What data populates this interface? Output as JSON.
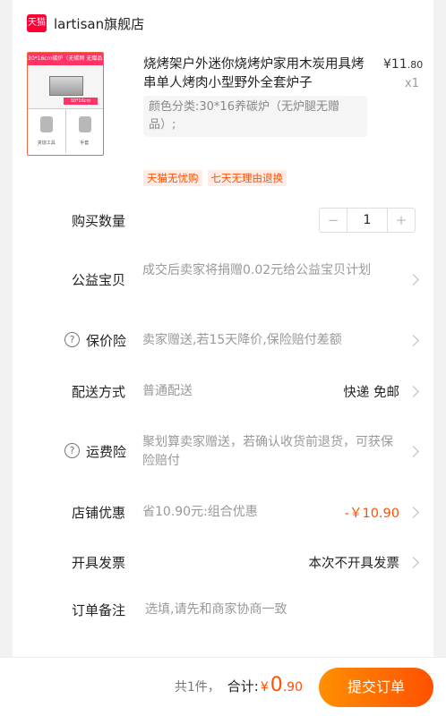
{
  "store": {
    "logo_text": "天猫",
    "name": "lartisan旗舰店"
  },
  "product": {
    "thumb_banner": "30*16cm碳炉（无碳网 无赠品）",
    "thumb_dim": "30*16cm",
    "thumb_captions": [
      "夹烧工具",
      "手套"
    ],
    "title": "烧烤架户外迷你烧烤炉家用木炭用具烤串单人烤肉小型野外全套炉子",
    "price_symbol": "¥",
    "price_int": "11",
    "price_dec": ".80",
    "quantity_text": "x1",
    "spec": "颜色分类:30*16养碳炉（无炉腿无赠品）;",
    "tags": [
      "天猫无忧购",
      "七天无理由退换"
    ]
  },
  "purchase_qty": {
    "label": "购买数量",
    "minus": "−",
    "value": "1",
    "plus": "+"
  },
  "charity": {
    "label": "公益宝贝",
    "desc": "成交后卖家将捐赠0.02元给公益宝贝计划"
  },
  "price_protect": {
    "label": "保价险",
    "desc": "卖家赠送,若15天降价,保险赔付差额"
  },
  "shipping": {
    "label": "配送方式",
    "desc": "普通配送",
    "value": "快递 免邮"
  },
  "freight_insurance": {
    "label": "运费险",
    "desc": "聚划算卖家赠送，若确认收货前退货，可获保险赔付"
  },
  "store_discount": {
    "label": "店铺优惠",
    "desc": "省10.90元:组合优惠",
    "value": "-￥10.90"
  },
  "invoice": {
    "label": "开具发票",
    "value": "本次不开具发票"
  },
  "order_note": {
    "label": "订单备注",
    "placeholder": "选填,请先和商家协商一致"
  },
  "footer": {
    "count": "共1件，",
    "total_label": "合计:",
    "currency": "¥",
    "total_int": "0",
    "total_dec": ".90",
    "submit_label": "提交订单"
  },
  "colors": {
    "accent": "#ff5000",
    "tmall_red": "#ff0036",
    "button_gradient_start": "#ff9000"
  },
  "icons": [
    "tmall-logo-icon",
    "question-circle-icon",
    "chevron-right-icon"
  ]
}
